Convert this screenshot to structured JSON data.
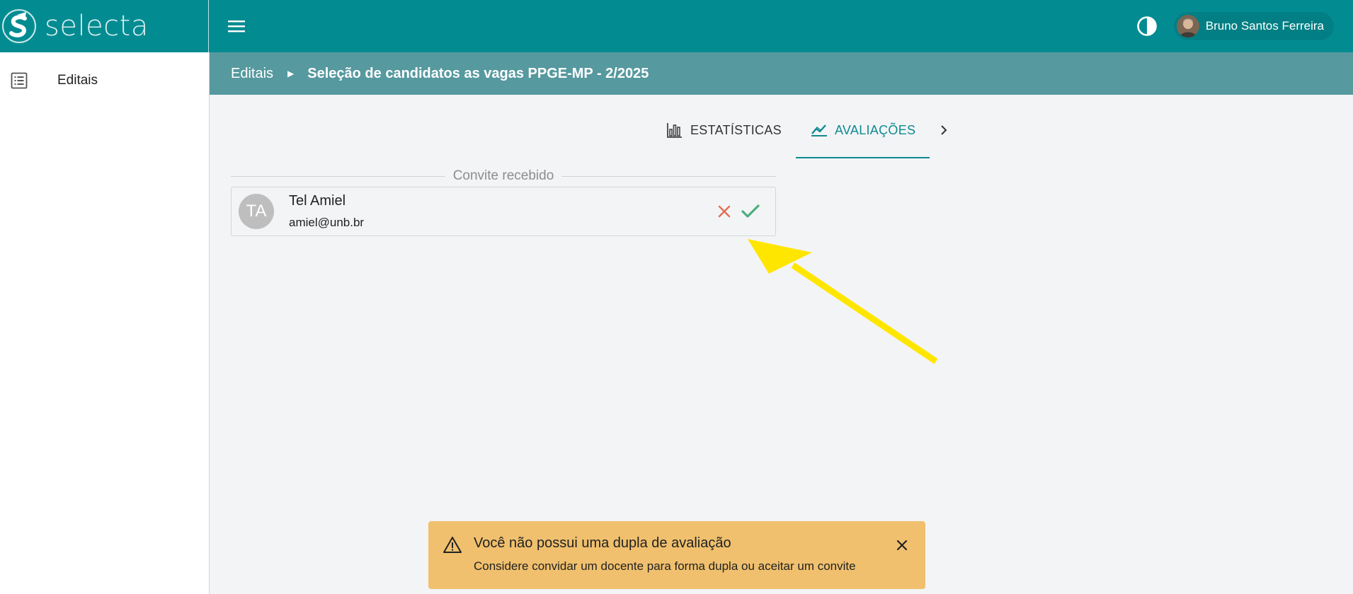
{
  "app": {
    "name": "selecta",
    "primary_color": "#028c92",
    "logo_icon": "selecta-logo-icon",
    "menu_icon": "hamburger-menu-icon",
    "contrast_icon": "contrast-toggle-icon"
  },
  "user": {
    "name": "Bruno Santos Ferreira"
  },
  "sidebar": {
    "items": [
      {
        "label": "Editais",
        "icon": "list-icon"
      }
    ]
  },
  "breadcrumb": {
    "parent": "Editais",
    "current": "Seleção de candidatos as vagas PPGE-MP - 2/2025"
  },
  "tabs": [
    {
      "label": "ESTATÍSTICAS",
      "icon": "bar-chart-icon",
      "active": false
    },
    {
      "label": "AVALIAÇÕES",
      "icon": "line-chart-icon",
      "active": true
    }
  ],
  "invites": {
    "section_title": "Convite recebido",
    "items": [
      {
        "initials": "TA",
        "name": "Tel Amiel",
        "email": "amiel@unb.br"
      }
    ]
  },
  "toast": {
    "type": "warning",
    "color": "#f0c06e",
    "title": "Você não possui uma dupla de avaliação",
    "message": "Considere convidar um docente para forma dupla ou aceitar um convite"
  },
  "annotation": {
    "color": "#ffe600"
  }
}
